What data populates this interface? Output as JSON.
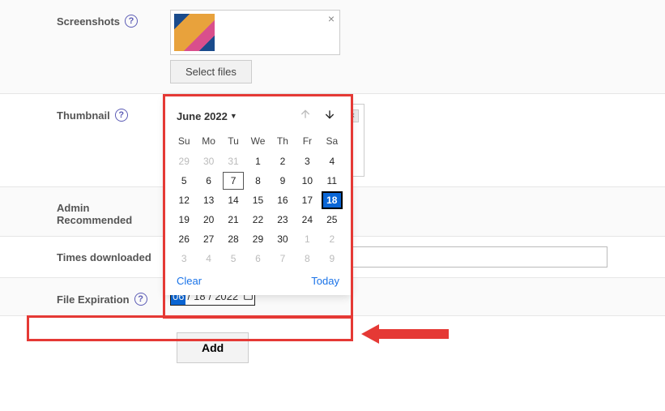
{
  "labels": {
    "screenshots": "Screenshots",
    "thumbnail": "Thumbnail",
    "admin_rec_line1": "Admin",
    "admin_rec_line2": "Recommended",
    "times_downloaded": "Times downloaded",
    "file_expiration": "File Expiration"
  },
  "buttons": {
    "select_files": "Select files",
    "add": "Add"
  },
  "times_downloaded_value": "",
  "date_input": {
    "month": "06",
    "sep": "/",
    "day": "18",
    "year": "2022"
  },
  "calendar": {
    "title": "June 2022",
    "dow": [
      "Su",
      "Mo",
      "Tu",
      "We",
      "Th",
      "Fr",
      "Sa"
    ],
    "footer_clear": "Clear",
    "footer_today": "Today",
    "cells": [
      {
        "d": 29,
        "kind": "other"
      },
      {
        "d": 30,
        "kind": "other"
      },
      {
        "d": 31,
        "kind": "other"
      },
      {
        "d": 1,
        "kind": "cur"
      },
      {
        "d": 2,
        "kind": "cur"
      },
      {
        "d": 3,
        "kind": "cur"
      },
      {
        "d": 4,
        "kind": "cur"
      },
      {
        "d": 5,
        "kind": "cur"
      },
      {
        "d": 6,
        "kind": "cur"
      },
      {
        "d": 7,
        "kind": "today"
      },
      {
        "d": 8,
        "kind": "cur"
      },
      {
        "d": 9,
        "kind": "cur"
      },
      {
        "d": 10,
        "kind": "cur"
      },
      {
        "d": 11,
        "kind": "cur"
      },
      {
        "d": 12,
        "kind": "cur"
      },
      {
        "d": 13,
        "kind": "cur"
      },
      {
        "d": 14,
        "kind": "cur"
      },
      {
        "d": 15,
        "kind": "cur"
      },
      {
        "d": 16,
        "kind": "cur"
      },
      {
        "d": 17,
        "kind": "cur"
      },
      {
        "d": 18,
        "kind": "selected"
      },
      {
        "d": 19,
        "kind": "cur"
      },
      {
        "d": 20,
        "kind": "cur"
      },
      {
        "d": 21,
        "kind": "cur"
      },
      {
        "d": 22,
        "kind": "cur"
      },
      {
        "d": 23,
        "kind": "cur"
      },
      {
        "d": 24,
        "kind": "cur"
      },
      {
        "d": 25,
        "kind": "cur"
      },
      {
        "d": 26,
        "kind": "cur"
      },
      {
        "d": 27,
        "kind": "cur"
      },
      {
        "d": 28,
        "kind": "cur"
      },
      {
        "d": 29,
        "kind": "cur"
      },
      {
        "d": 30,
        "kind": "cur"
      },
      {
        "d": 1,
        "kind": "other"
      },
      {
        "d": 2,
        "kind": "other"
      },
      {
        "d": 3,
        "kind": "other"
      },
      {
        "d": 4,
        "kind": "other"
      },
      {
        "d": 5,
        "kind": "other"
      },
      {
        "d": 6,
        "kind": "other"
      },
      {
        "d": 7,
        "kind": "other"
      },
      {
        "d": 8,
        "kind": "other"
      },
      {
        "d": 9,
        "kind": "other"
      }
    ]
  },
  "icons": {
    "help": "?",
    "close": "×",
    "caret": "▼",
    "calendar": "📅"
  }
}
